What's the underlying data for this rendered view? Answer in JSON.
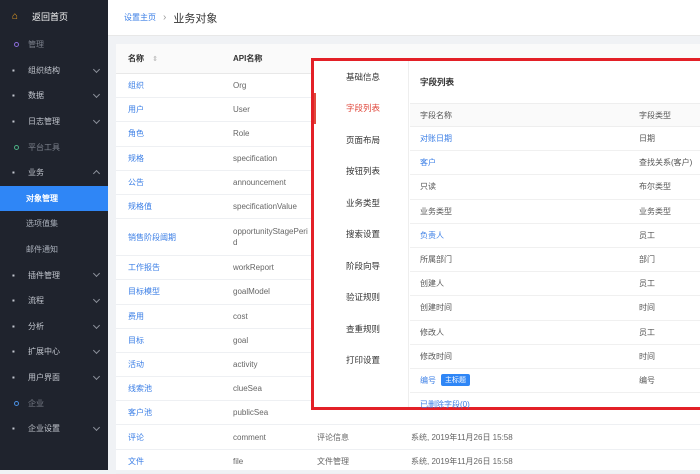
{
  "sidebar": {
    "home": "返回首页",
    "items": [
      {
        "label": "管理",
        "type": "section",
        "dot": "purple"
      },
      {
        "label": "组织结构",
        "type": "item",
        "icon": "org-icon",
        "chev": "down"
      },
      {
        "label": "数据",
        "type": "item",
        "icon": "data-icon",
        "chev": "down"
      },
      {
        "label": "日志管理",
        "type": "item",
        "icon": "log-icon",
        "chev": "down"
      },
      {
        "label": "平台工具",
        "type": "section",
        "dot": "green"
      },
      {
        "label": "业务",
        "type": "item",
        "icon": "business-icon",
        "chev": "up"
      },
      {
        "label": "对象管理",
        "type": "sub",
        "active": true
      },
      {
        "label": "选项值集",
        "type": "sub"
      },
      {
        "label": "邮件通知",
        "type": "sub"
      },
      {
        "label": "插件管理",
        "type": "item",
        "icon": "plugin-icon",
        "chev": "down"
      },
      {
        "label": "流程",
        "type": "item",
        "icon": "flow-icon",
        "chev": "down"
      },
      {
        "label": "分析",
        "type": "item",
        "icon": "analysis-icon",
        "chev": "down"
      },
      {
        "label": "扩展中心",
        "type": "item",
        "icon": "extension-icon",
        "chev": "down"
      },
      {
        "label": "用户界面",
        "type": "item",
        "icon": "ui-icon",
        "chev": "down"
      },
      {
        "label": "企业",
        "type": "section",
        "dot": "blue"
      },
      {
        "label": "企业设置",
        "type": "item",
        "icon": "enterprise-icon",
        "chev": "down"
      }
    ]
  },
  "header": {
    "crumb_link": "设置主页",
    "crumb_sep": "›",
    "title": "业务对象"
  },
  "table": {
    "columns": [
      "名称",
      "API名称"
    ],
    "sort_glyph": "⇕",
    "rows": [
      {
        "name": "组织",
        "api": "Org"
      },
      {
        "name": "用户",
        "api": "User"
      },
      {
        "name": "角色",
        "api": "Role"
      },
      {
        "name": "规格",
        "api": "specification"
      },
      {
        "name": "公告",
        "api": "announcement"
      },
      {
        "name": "规格值",
        "api": "specificationValue"
      },
      {
        "name": "销售阶段阈期",
        "api": "opportunityStagePeri d",
        "tall": true
      },
      {
        "name": "工作报告",
        "api": "workReport"
      },
      {
        "name": "目标模型",
        "api": "goalModel"
      },
      {
        "name": "费用",
        "api": "cost"
      },
      {
        "name": "目标",
        "api": "goal"
      },
      {
        "name": "活动",
        "api": "activity"
      },
      {
        "name": "线索池",
        "api": "clueSea"
      },
      {
        "name": "客户池",
        "api": "publicSea"
      },
      {
        "name": "评论",
        "api": "comment",
        "desc": "评论信息",
        "updated": "系统, 2019年11月26日 15:58"
      },
      {
        "name": "文件",
        "api": "file",
        "desc": "文件管理",
        "updated": "系统, 2019年11月26日 15:58"
      }
    ]
  },
  "panel": {
    "menu": [
      {
        "label": "基础信息"
      },
      {
        "label": "字段列表",
        "active": true
      },
      {
        "label": "页面布局"
      },
      {
        "label": "按钮列表"
      },
      {
        "label": "业务类型"
      },
      {
        "label": "搜索设置"
      },
      {
        "label": "阶段向导"
      },
      {
        "label": "验证规则"
      },
      {
        "label": "查重规则"
      },
      {
        "label": "打印设置"
      }
    ],
    "title": "字段列表",
    "columns": [
      "字段名称",
      "字段类型"
    ],
    "fields": [
      {
        "name": "对账日期",
        "type": "日期",
        "link": true
      },
      {
        "name": "客户",
        "type": "查找关系(客户)",
        "link": true
      },
      {
        "name": "只读",
        "type": "布尔类型"
      },
      {
        "name": "业务类型",
        "type": "业务类型"
      },
      {
        "name": "负责人",
        "type": "员工",
        "link": true
      },
      {
        "name": "所属部门",
        "type": "部门"
      },
      {
        "name": "创建人",
        "type": "员工"
      },
      {
        "name": "创建时间",
        "type": "时间"
      },
      {
        "name": "修改人",
        "type": "员工"
      },
      {
        "name": "修改时间",
        "type": "时间"
      },
      {
        "name": "编号",
        "type": "编号",
        "link": true,
        "badge": "主标题"
      }
    ],
    "deleted_link": "已删除字段(0)"
  },
  "colors": {
    "accent": "#2f86f6",
    "highlight": "#e32027",
    "active_tab": "#e0483c"
  }
}
